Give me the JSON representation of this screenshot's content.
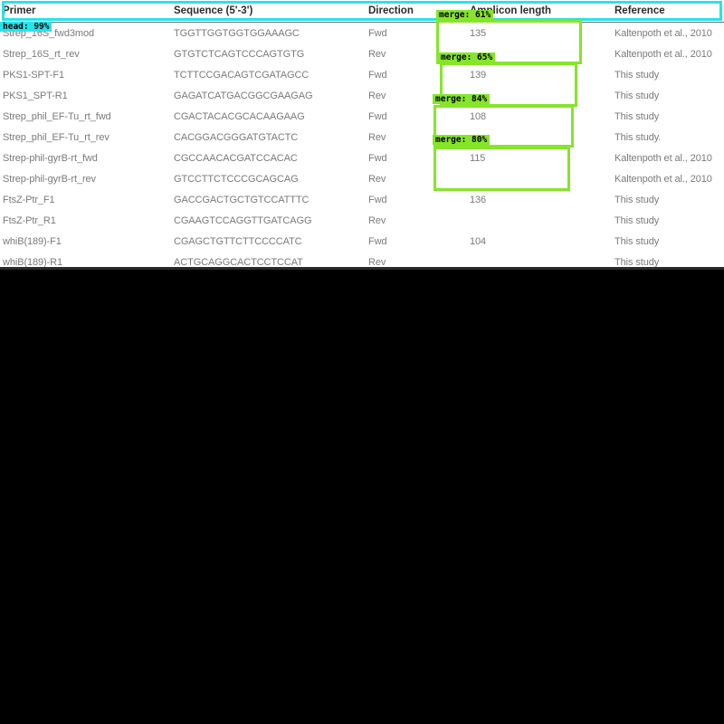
{
  "table": {
    "headers": [
      "Primer",
      "Sequence (5'-3')",
      "Direction",
      "Amplicon length",
      "Reference"
    ],
    "rows": [
      [
        "Strep_16S_fwd3mod",
        "TGGTTGGTGGTGGAAAGC",
        "Fwd",
        "135",
        "Kaltenpoth et al., 2010"
      ],
      [
        "Strep_16S_rt_rev",
        "GTGTCTCAGTCCCAGTGTG",
        "Rev",
        "",
        "Kaltenpoth et al., 2010"
      ],
      [
        "PKS1-SPT-F1",
        "TCTTCCGACAGTCGATAGCC",
        "Fwd",
        "139",
        "This study"
      ],
      [
        "PKS1_SPT-R1",
        "GAGATCATGACGGCGAAGAG",
        "Rev",
        "",
        "This study"
      ],
      [
        "Strep_phil_EF-Tu_rt_fwd",
        "CGACTACACGCACAAGAAG",
        "Fwd",
        "108",
        "This study"
      ],
      [
        "Strep_phil_EF-Tu_rt_rev",
        "CACGGACGGGATGTACTC",
        "Rev",
        "",
        "This study."
      ],
      [
        "Strep-phil-gyrB-rt_fwd",
        "CGCCAACACGATCCACAC",
        "Fwd",
        "115",
        "Kaltenpoth et al., 2010"
      ],
      [
        "Strep-phil-gyrB-rt_rev",
        "GTCCTTCTCCCGCAGCAG",
        "Rev",
        "",
        "Kaltenpoth et al., 2010"
      ],
      [
        "FtsZ-Ptr_F1",
        "GACCGACTGCTGTCCATTTC",
        "Fwd",
        "136",
        "This study"
      ],
      [
        "FtsZ-Ptr_R1",
        "CGAAGTCCAGGTTGATCAGG",
        "Rev",
        "",
        "This study"
      ],
      [
        "whiB(189)-F1",
        "CGAGCTGTTCTTCCCCATC",
        "Fwd",
        "104",
        "This study"
      ],
      [
        "whiB(189)-R1",
        "ACTGCAGGCACTCCTCCAT",
        "Rev",
        "",
        "This study"
      ]
    ]
  },
  "overlays": {
    "head_label": "head: 99%",
    "merge_labels": [
      "merge: 61%",
      "merge: 65%",
      "merge: 84%",
      "merge: 80%"
    ]
  },
  "colors": {
    "head_box": "#27e3e9",
    "merge_box": "#86e52a",
    "background": "#000000"
  }
}
